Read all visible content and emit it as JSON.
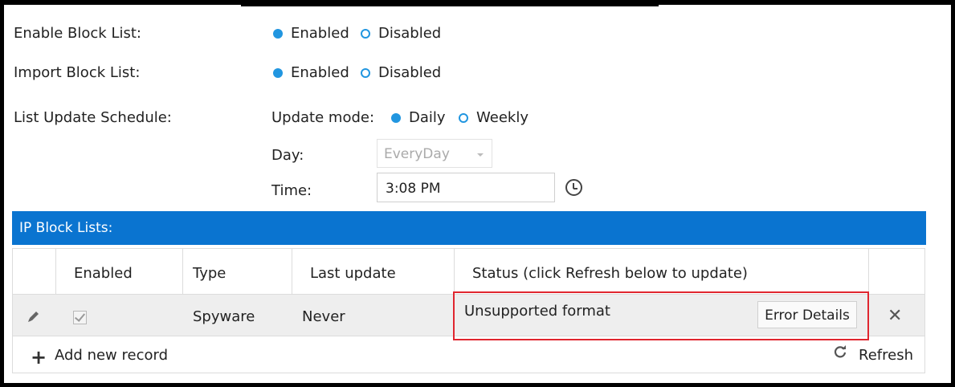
{
  "settings": {
    "enable_block_list": {
      "label": "Enable Block List:",
      "options": [
        "Enabled",
        "Disabled"
      ],
      "selected": "Enabled"
    },
    "import_block_list": {
      "label": "Import Block List:",
      "options": [
        "Enabled",
        "Disabled"
      ],
      "selected": "Enabled"
    },
    "list_update_schedule": {
      "label": "List Update Schedule:",
      "update_mode_label": "Update mode:",
      "update_mode_options": [
        "Daily",
        "Weekly"
      ],
      "update_mode_selected": "Daily",
      "day_label": "Day:",
      "day_value": "EveryDay",
      "time_label": "Time:",
      "time_value": "3:08 PM"
    }
  },
  "ip_block_lists": {
    "title": "IP Block Lists:",
    "columns": [
      "Enabled",
      "Type",
      "Last update",
      "Status (click Refresh below to update)"
    ],
    "rows": [
      {
        "enabled": true,
        "type": "Spyware",
        "last_update": "Never",
        "status": "Unsupported format",
        "action_label": "Error Details"
      }
    ],
    "add_label": "Add new record",
    "refresh_label": "Refresh"
  },
  "colors": {
    "accent": "#2196e0",
    "header_bar": "#0a74d0",
    "highlight_box": "#e0262f"
  },
  "icons": [
    "pencil-icon",
    "checkbox-icon",
    "delete-icon",
    "plus-icon",
    "refresh-icon",
    "clock-icon",
    "chevron-down-icon"
  ]
}
